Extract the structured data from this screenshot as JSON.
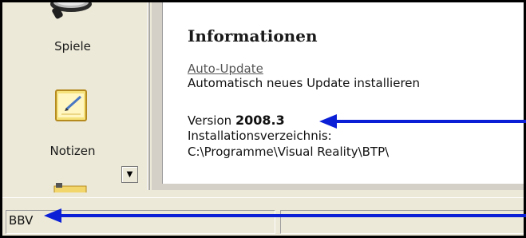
{
  "sidebar": {
    "items": [
      {
        "label": "Spiele",
        "icon": "joystick-icon"
      },
      {
        "label": "Notizen",
        "icon": "notepad-icon"
      }
    ],
    "scroll_glyph": "▼"
  },
  "info": {
    "title": "Informationen",
    "auto_update_link": "Auto-Update",
    "auto_update_desc": "Automatisch neues Update installieren",
    "version_label": "Version",
    "version_value": "2008.3",
    "install_dir_label": "Installationsverzeichnis:",
    "install_dir_path": "C:\\Programme\\Visual Reality\\BTP\\"
  },
  "statusbar": {
    "left_text": "BBV",
    "right_text": ""
  },
  "colors": {
    "arrow": "#0a1fd6",
    "window_bg": "#ece9d8",
    "content_bg": "#ffffff"
  }
}
